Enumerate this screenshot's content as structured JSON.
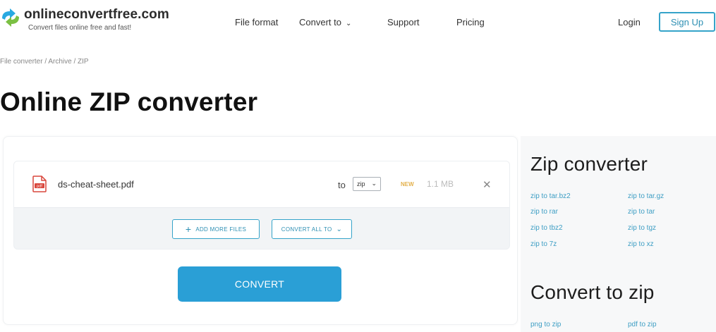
{
  "header": {
    "logo": {
      "name": "onlineconvertfree.com",
      "tagline": "Convert files online free and fast!",
      "icon": "refresh-arrows-icon"
    },
    "nav": {
      "file_format": "File format",
      "convert_to": "Convert to",
      "support": "Support",
      "pricing": "Pricing",
      "login": "Login",
      "signup": "Sign Up"
    }
  },
  "breadcrumb": "File converter / Archive / ZIP",
  "page_title": "Online ZIP converter",
  "converter": {
    "file": {
      "name": "ds-cheat-sheet.pdf",
      "icon": "pdf-file-icon",
      "to_label": "to",
      "format": "zip",
      "status": "NEW",
      "size": "1.1 MB"
    },
    "add_more": "ADD MORE FILES",
    "convert_all": "CONVERT ALL TO",
    "convert": "CONVERT"
  },
  "sidebar": {
    "zip_converter_title": "Zip converter",
    "zip_links": [
      "zip to tar.bz2",
      "zip to tar.gz",
      "zip to rar",
      "zip to tar",
      "zip to tbz2",
      "zip to tgz",
      "zip to 7z",
      "zip to xz"
    ],
    "convert_to_zip_title": "Convert to zip",
    "to_zip_links": [
      "png to zip",
      "pdf to zip"
    ]
  },
  "colors": {
    "accent": "#2a9fd6",
    "outline": "#35a3c9",
    "link": "#3e9ec4",
    "badge": "#e3b04b"
  }
}
